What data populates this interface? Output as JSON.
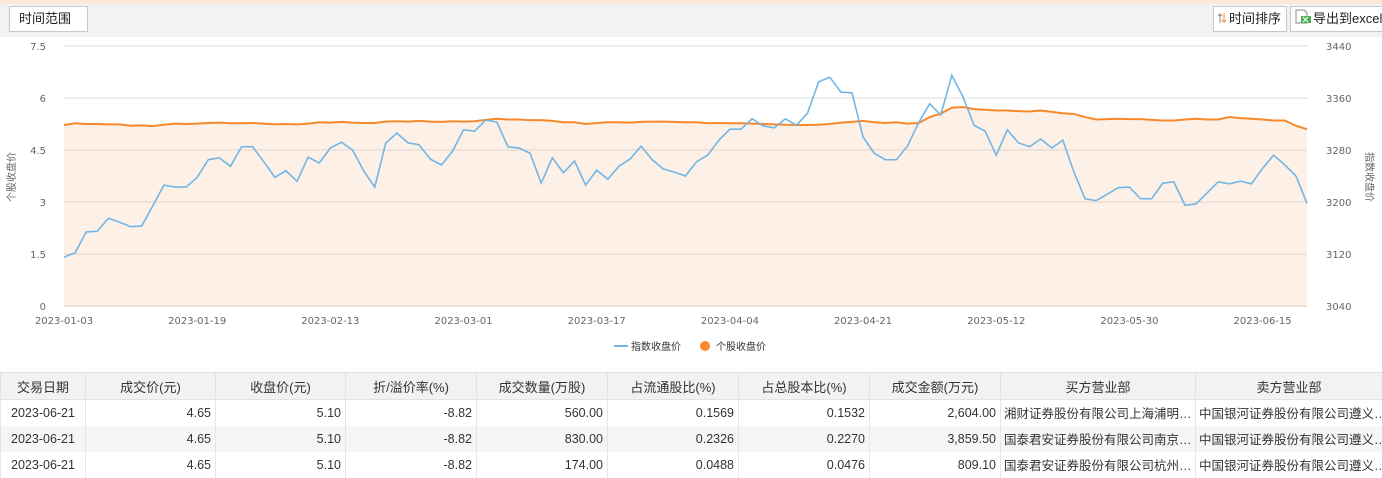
{
  "toolbar": {
    "range_label": "时间范围",
    "sort_label": "时间排序",
    "export_label": "导出到excel"
  },
  "chart_data": {
    "type": "line",
    "left_axis": {
      "label": "个股收盘价",
      "ylim": [
        0,
        7.5
      ],
      "ticks": [
        "0",
        "1.5",
        "3",
        "4.5",
        "6",
        "7.5"
      ]
    },
    "right_axis": {
      "label": "指数收盘价",
      "ylim": [
        3040,
        3440
      ],
      "ticks": [
        "3040",
        "3120",
        "3200",
        "3280",
        "3360",
        "3440"
      ]
    },
    "x_tick_labels": [
      "2023-01-03",
      "2023-01-19",
      "2023-02-13",
      "2023-03-01",
      "2023-03-17",
      "2023-04-04",
      "2023-04-21",
      "2023-05-12",
      "2023-05-30",
      "2023-06-15"
    ],
    "x_tick_every": 12,
    "legend": {
      "placement": "bottom-center",
      "items": [
        "指数收盘价",
        "个股收盘价"
      ]
    },
    "series": [
      {
        "name": "指数收盘价",
        "axis": "right",
        "color": "#72b6e6",
        "values": [
          3115,
          3122,
          3154,
          3155,
          3175,
          3169,
          3162,
          3163,
          3194,
          3226,
          3223,
          3223,
          3238,
          3265,
          3268,
          3255,
          3285,
          3285,
          3262,
          3238,
          3248,
          3232,
          3269,
          3260,
          3283,
          3292,
          3280,
          3248,
          3223,
          3291,
          3306,
          3291,
          3288,
          3266,
          3257,
          3278,
          3311,
          3309,
          3326,
          3323,
          3285,
          3283,
          3275,
          3229,
          3268,
          3245,
          3263,
          3226,
          3249,
          3235,
          3255,
          3266,
          3286,
          3265,
          3251,
          3246,
          3240,
          3262,
          3272,
          3295,
          3312,
          3312,
          3328,
          3317,
          3314,
          3328,
          3318,
          3337,
          3385,
          3392,
          3369,
          3368,
          3300,
          3275,
          3265,
          3265,
          3286,
          3322,
          3351,
          3334,
          3395,
          3362,
          3318,
          3309,
          3272,
          3311,
          3291,
          3285,
          3297,
          3283,
          3295,
          3246,
          3205,
          3202,
          3212,
          3222,
          3223,
          3205,
          3205,
          3229,
          3231,
          3195,
          3197,
          3214,
          3231,
          3228,
          3232,
          3228,
          3252,
          3272,
          3257,
          3240,
          3198
        ]
      },
      {
        "name": "个股收盘价",
        "axis": "left",
        "color": "#f7892c",
        "values": [
          5.22,
          5.27,
          5.25,
          5.25,
          5.24,
          5.24,
          5.2,
          5.21,
          5.19,
          5.23,
          5.26,
          5.25,
          5.26,
          5.28,
          5.29,
          5.27,
          5.27,
          5.28,
          5.26,
          5.24,
          5.25,
          5.24,
          5.26,
          5.3,
          5.29,
          5.31,
          5.29,
          5.28,
          5.28,
          5.32,
          5.33,
          5.32,
          5.34,
          5.32,
          5.31,
          5.33,
          5.32,
          5.33,
          5.37,
          5.4,
          5.38,
          5.38,
          5.36,
          5.36,
          5.34,
          5.3,
          5.3,
          5.25,
          5.28,
          5.3,
          5.3,
          5.29,
          5.31,
          5.32,
          5.32,
          5.31,
          5.3,
          5.3,
          5.27,
          5.28,
          5.27,
          5.27,
          5.26,
          5.25,
          5.24,
          5.23,
          5.22,
          5.22,
          5.23,
          5.25,
          5.29,
          5.31,
          5.34,
          5.3,
          5.28,
          5.3,
          5.26,
          5.28,
          5.45,
          5.55,
          5.72,
          5.74,
          5.68,
          5.66,
          5.64,
          5.64,
          5.62,
          5.61,
          5.64,
          5.6,
          5.56,
          5.54,
          5.45,
          5.38,
          5.39,
          5.4,
          5.39,
          5.39,
          5.37,
          5.35,
          5.35,
          5.38,
          5.4,
          5.38,
          5.38,
          5.45,
          5.42,
          5.4,
          5.38,
          5.35,
          5.35,
          5.2,
          5.1
        ]
      }
    ]
  },
  "table": {
    "headers": [
      "交易日期",
      "成交价(元)",
      "收盘价(元)",
      "折/溢价率(%)",
      "成交数量(万股)",
      "占流通股比(%)",
      "占总股本比(%)",
      "成交金额(万元)",
      "买方营业部",
      "卖方营业部"
    ],
    "rows": [
      [
        "2023-06-21",
        "4.65",
        "5.10",
        "-8.82",
        "560.00",
        "0.1569",
        "0.1532",
        "2,604.00",
        "湘财证券股份有限公司上海浦明…",
        "中国银河证券股份有限公司遵义…"
      ],
      [
        "2023-06-21",
        "4.65",
        "5.10",
        "-8.82",
        "830.00",
        "0.2326",
        "0.2270",
        "3,859.50",
        "国泰君安证券股份有限公司南京…",
        "中国银河证券股份有限公司遵义…"
      ],
      [
        "2023-06-21",
        "4.65",
        "5.10",
        "-8.82",
        "174.00",
        "0.0488",
        "0.0476",
        "809.10",
        "国泰君安证券股份有限公司杭州…",
        "中国银河证券股份有限公司遵义…"
      ]
    ]
  }
}
